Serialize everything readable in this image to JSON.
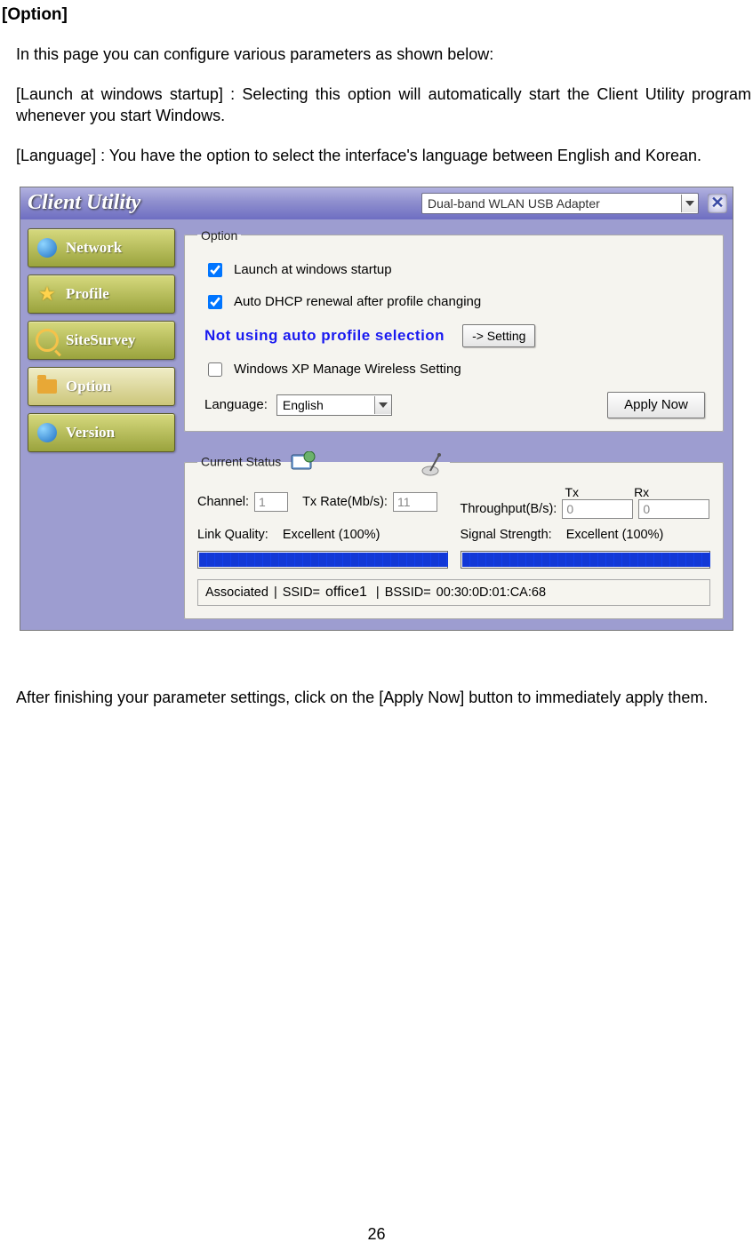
{
  "doc": {
    "heading": "[Option]",
    "p1": "In this page you can configure various parameters as shown below:",
    "p2": "[Launch at windows startup] : Selecting this option will automatically start the Client Utility program whenever you start Windows.",
    "p3": "[Language] : You have the option to select the interface's language between English and Korean.",
    "outro": "After finishing your parameter settings, click on the [Apply Now] button to immediately apply them.",
    "page_number": "26"
  },
  "app": {
    "title": "Client Utility",
    "adapter_selected": "Dual-band WLAN USB Adapter",
    "nav": [
      {
        "label": "Network",
        "icon": "globe-icon"
      },
      {
        "label": "Profile",
        "icon": "star-icon"
      },
      {
        "label": "SiteSurvey",
        "icon": "search-icon"
      },
      {
        "label": "Option",
        "icon": "folder-icon"
      },
      {
        "label": "Version",
        "icon": "globe-icon"
      }
    ],
    "option_panel": {
      "legend": "Option",
      "chk_launch": {
        "label": "Launch at windows startup",
        "checked": true
      },
      "chk_dhcp": {
        "label": "Auto DHCP renewal after profile changing",
        "checked": true
      },
      "note_msg": "Not using auto profile selection",
      "setting_btn": "-> Setting",
      "chk_xp": {
        "label": "Windows XP Manage Wireless Setting",
        "checked": false
      },
      "language_label": "Language:",
      "language_value": "English",
      "apply_btn": "Apply Now"
    },
    "status_panel": {
      "legend": "Current Status",
      "channel_label": "Channel:",
      "channel_value": "1",
      "txrate_label": "Tx Rate(Mb/s):",
      "txrate_value": "11",
      "throughput_label": "Throughput(B/s):",
      "tx_col": "Tx",
      "rx_col": "Rx",
      "tx_value": "0",
      "rx_value": "0",
      "lq_label": "Link Quality:",
      "lq_value": "Excellent (100%)",
      "ss_label": "Signal Strength:",
      "ss_value": "Excellent (100%)",
      "lq_pct": 100,
      "ss_pct": 100
    },
    "statusbar": {
      "assoc": "Associated",
      "ssid_label": "SSID=",
      "ssid": "office1",
      "bssid_label": "BSSID=",
      "bssid": "00:30:0D:01:CA:68"
    }
  }
}
